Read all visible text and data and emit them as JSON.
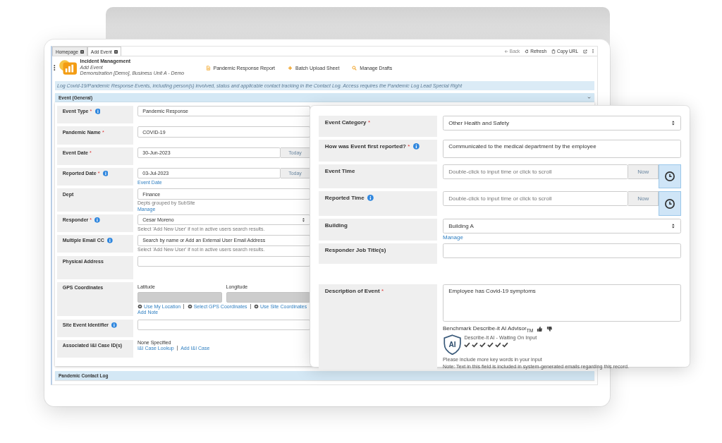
{
  "tabs": [
    {
      "label": "Homepage",
      "selected": false
    },
    {
      "label": "Add Event",
      "selected": true
    }
  ],
  "top_actions": [
    {
      "kind": "back",
      "label": "Back",
      "disabled": true
    },
    {
      "kind": "refresh",
      "label": "Refresh",
      "disabled": false
    },
    {
      "kind": "copy",
      "label": "Copy URL",
      "disabled": false
    }
  ],
  "header": {
    "title": "Incident Management",
    "subtitle": "Add Event",
    "context": "Demonstration [Demo], Business Unit A - Demo"
  },
  "toolbar": [
    {
      "kind": "report",
      "label": "Pandemic Response Report"
    },
    {
      "kind": "add",
      "label": "Batch Upload Sheet"
    },
    {
      "kind": "search",
      "label": "Manage Drafts"
    }
  ],
  "banner": "Log Covid-19/Pandemic Response Events, including person(s) involved, status and applicable contact tracking in the Contact Log. Access requires the Pandemic Log Lead Special Right",
  "form": {
    "section": {
      "title": "Event (General)",
      "expanded": true
    },
    "fields": [
      {
        "kind": "text",
        "label": "Event Type",
        "mark": "*",
        "help": true,
        "value": "Pandemic Response"
      },
      {
        "kind": "text",
        "label": "Pandemic Name",
        "mark": "*",
        "value": "COVID-19"
      },
      {
        "kind": "date",
        "label": "Event Date",
        "mark": "*",
        "value": "30-Jun-2023",
        "button": "Today"
      },
      {
        "kind": "date",
        "label": "Reported Date",
        "mark": "*",
        "help": true,
        "value": "03-Jul-2023",
        "button": "Today",
        "links": [
          "Event Date"
        ]
      },
      {
        "kind": "text",
        "label": "Dept",
        "value": "Finance",
        "helper": "Depts grouped by SubSite",
        "links": [
          "Manage"
        ]
      },
      {
        "kind": "select",
        "label": "Responder",
        "mark": "*",
        "help": true,
        "value": "Cesar Moreno",
        "helper": "Select 'Add New User' if not in active users search results."
      },
      {
        "kind": "text",
        "label": "Multiple Email CC",
        "help": true,
        "placeholder": "Search by name or Add an External User Email Address",
        "helper": "Select 'Add New User' if not in active users search results."
      },
      {
        "kind": "address",
        "label": "Physical Address"
      },
      {
        "kind": "gps",
        "label": "GPS Coordinates",
        "inputs": [
          "Latitude",
          "Longitude"
        ],
        "links": [
          "Use My Location",
          "Select GPS Coordinates",
          "Use Site Coordinates"
        ],
        "extra_links": [
          "Add Note"
        ]
      },
      {
        "kind": "text",
        "label": "Site Event Identifier",
        "help": true
      },
      {
        "kind": "static",
        "label": "Associated I&I Case ID(s)",
        "value": "None Specified",
        "links": [
          "I&I Case Lookup",
          "Add I&I Case"
        ]
      }
    ]
  },
  "contact_log": {
    "title": "Pandemic Contact Log"
  },
  "detail_card": {
    "fields": [
      {
        "kind": "select",
        "label": "Event Category",
        "mark": "*",
        "value": "Other Health and Safety"
      },
      {
        "kind": "textarea",
        "label": "How was Event first reported?",
        "mark": "*",
        "help": true,
        "value": "Communicated to the medical department by the employee"
      },
      {
        "kind": "time",
        "label": "Event Time",
        "placeholder": "Double-click to input time or click to scroll",
        "button": "Now"
      },
      {
        "kind": "time",
        "label": "Reported Time",
        "help": true,
        "placeholder": "Double-click to input time or click to scroll",
        "button": "Now"
      },
      {
        "kind": "select",
        "label": "Building",
        "value": "Building A",
        "links": [
          "Manage"
        ]
      },
      {
        "kind": "text",
        "label": "Responder Job Title(s)"
      },
      {
        "kind": "description",
        "label": "Description of Event",
        "mark": "*",
        "value": "Employee has Covid-19 symptoms",
        "advisor": {
          "title": "Benchmark Describe-it AI Advisor$_{TM}$",
          "badge": "AI",
          "status": "Describe-It AI - Waiting On Input",
          "hint": "Please include more key words in your input",
          "note": "Note: Text in this field is included in system-generated emails regarding this record."
        }
      }
    ]
  }
}
